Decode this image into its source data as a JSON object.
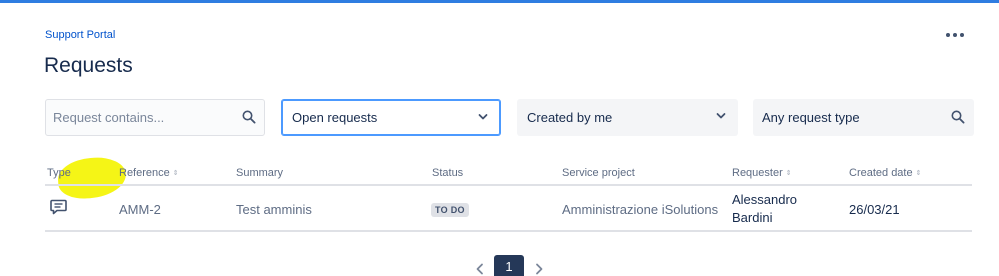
{
  "header": {
    "breadcrumb": "Support Portal",
    "title": "Requests"
  },
  "filters": {
    "search_placeholder": "Request contains...",
    "status_filter": "Open requests",
    "owner_filter": "Created by me",
    "request_type_filter": "Any request type"
  },
  "table": {
    "columns": [
      "Type",
      "Reference",
      "Summary",
      "Status",
      "Service project",
      "Requester",
      "Created date"
    ],
    "rows": [
      {
        "type_icon": "comment-icon",
        "reference": "AMM-2",
        "summary": "Test amminis",
        "status": "TO DO",
        "service_project": "Amministrazione iSolutions",
        "requester_line1": "Alessandro",
        "requester_line2": "Bardini",
        "created_date": "26/03/21"
      }
    ]
  },
  "pagination": {
    "current_page": "1",
    "prev_icon": "chevron-left-icon",
    "next_icon": "chevron-right-icon"
  },
  "colors": {
    "accent": "#2f7de1",
    "highlight": "#f4f40a",
    "lozenge_bg": "#dfe1e6"
  }
}
